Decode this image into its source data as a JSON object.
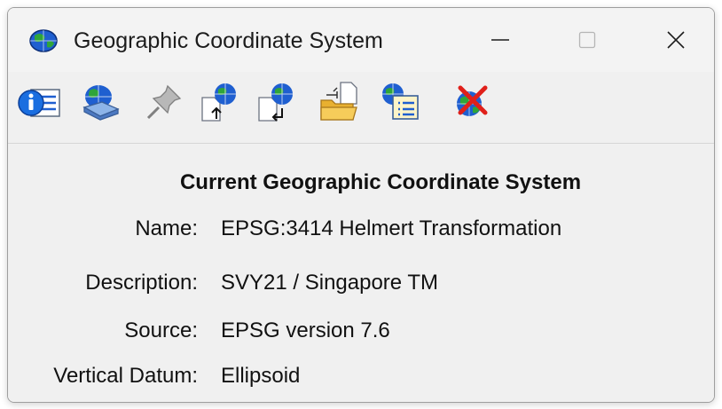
{
  "window": {
    "title": "Geographic Coordinate System",
    "controls": {
      "minimize": "minimize-icon",
      "maximize": "maximize-icon",
      "close": "close-icon"
    }
  },
  "toolbar": {
    "buttons": [
      {
        "name": "info",
        "icon": "info-list-icon"
      },
      {
        "name": "select-from-library",
        "icon": "globe-database-icon"
      },
      {
        "name": "pin",
        "icon": "pushpin-icon"
      },
      {
        "name": "import",
        "icon": "globe-file-import-icon"
      },
      {
        "name": "export",
        "icon": "globe-file-export-icon"
      },
      {
        "name": "open-file",
        "icon": "folder-file-icon"
      },
      {
        "name": "properties",
        "icon": "globe-list-icon"
      },
      {
        "name": "delete",
        "icon": "globe-delete-icon"
      }
    ]
  },
  "main": {
    "heading": "Current Geographic Coordinate System",
    "fields": [
      {
        "label": "Name:",
        "value": "EPSG:3414 Helmert Transformation"
      },
      {
        "label": "Description:",
        "value": "SVY21 / Singapore TM"
      },
      {
        "label": "Source:",
        "value": "EPSG version 7.6"
      },
      {
        "label": "Vertical Datum:",
        "value": "Ellipsoid"
      }
    ]
  },
  "colors": {
    "globe_blue": "#1f5fd0",
    "globe_green": "#2fa53a",
    "delete_red": "#e0201a",
    "folder": "#f2c04a"
  }
}
